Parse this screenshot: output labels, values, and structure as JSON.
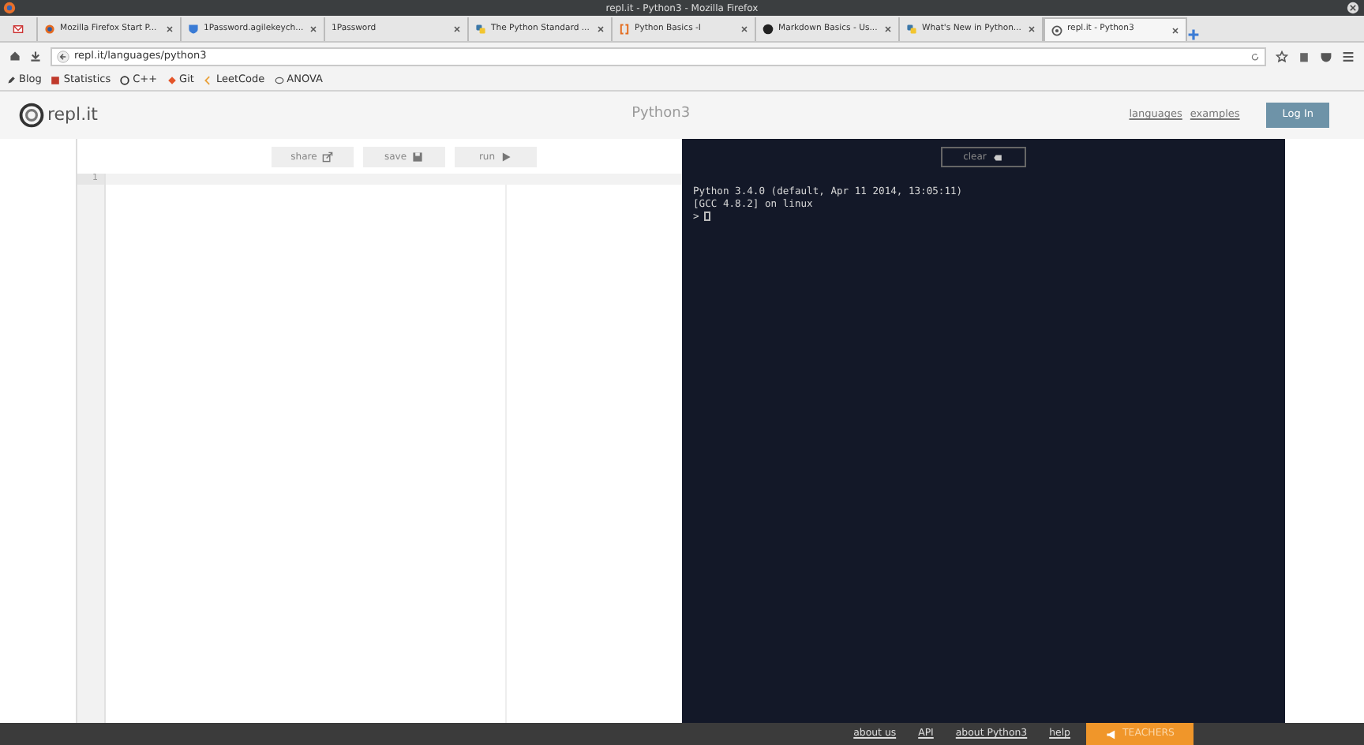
{
  "window": {
    "title": "repl.it - Python3 - Mozilla Firefox"
  },
  "tabs": [
    {
      "selected": false,
      "kind": "mail"
    },
    {
      "label": "Mozilla Firefox Start P...",
      "selected": false,
      "kind": "firefox"
    },
    {
      "label": "1Password.agilekeych...",
      "selected": false,
      "kind": "shield"
    },
    {
      "label": "1Password",
      "selected": false,
      "kind": "none"
    },
    {
      "label": "The Python Standard ...",
      "selected": false,
      "kind": "python"
    },
    {
      "label": "Python Basics -I",
      "selected": false,
      "kind": "bracket"
    },
    {
      "label": "Markdown Basics - Us...",
      "selected": false,
      "kind": "github"
    },
    {
      "label": "What's New in Python...",
      "selected": false,
      "kind": "python"
    },
    {
      "label": "repl.it - Python3",
      "selected": true,
      "kind": "repl"
    }
  ],
  "address": {
    "url": "repl.it/languages/python3"
  },
  "bookmarks": [
    {
      "label": "Blog",
      "kind": "pen"
    },
    {
      "label": "Statistics",
      "kind": "s"
    },
    {
      "label": "C++",
      "kind": "c"
    },
    {
      "label": "Git",
      "kind": "git"
    },
    {
      "label": "LeetCode",
      "kind": "leet"
    },
    {
      "label": "ANOVA",
      "kind": "r"
    }
  ],
  "header": {
    "logo": "repl.it",
    "title": "Python3",
    "links": [
      "languages",
      "examples"
    ],
    "login": "Log In"
  },
  "toolbar": [
    {
      "label": "share",
      "kind": "share"
    },
    {
      "label": "save",
      "kind": "save"
    },
    {
      "label": "run",
      "kind": "run"
    }
  ],
  "editor": {
    "line_numbers": [
      "1"
    ]
  },
  "console": {
    "clear": "clear",
    "lines": [
      "Python 3.4.0 (default, Apr 11 2014, 13:05:11)",
      "[GCC 4.8.2] on linux"
    ],
    "prompt": ">"
  },
  "footer": {
    "links": [
      "about us",
      "API",
      "about Python3",
      "help"
    ],
    "teachers": "TEACHERS"
  }
}
